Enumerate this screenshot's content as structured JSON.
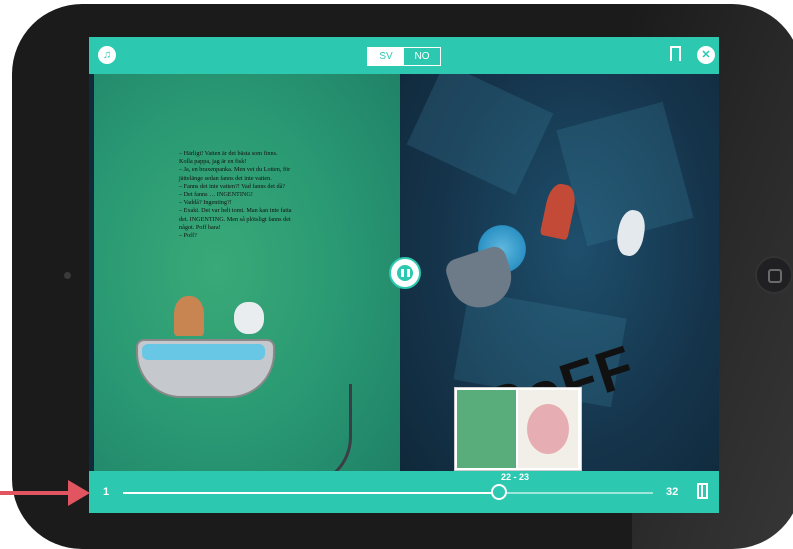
{
  "topbar": {
    "language_options": [
      "SV",
      "NO"
    ],
    "active_language": "SV",
    "icons": [
      "speaker-icon",
      "bookmark-icon",
      "close-icon"
    ]
  },
  "story": {
    "lines": [
      "– Härligt! Vatten är det bästa som finns.",
      "Kolla pappa, jag är en fisk!",
      "– Ja, en braxenpanka. Men vet du Lotten, för",
      "jättelänge sedan fanns det inte vatten.",
      "– Fanns det inte vatten?! Vad fanns det då?",
      "– Det fanns … INGENTING!",
      "– Vaddå? Ingenting?!",
      "– Exakt. Det var helt tomt. Man kan inte fatta",
      "det. INGENTING. Men så plötsligt fanns det",
      "något. Poff bara!",
      "– Poff?"
    ],
    "poff_word": "PoFF"
  },
  "player": {
    "pause_icon": "pause-icon",
    "current_spread": "22 - 23",
    "start_page": "1",
    "end_page": "32",
    "progress": 0.71,
    "end_icon": "book-icon"
  },
  "colors": {
    "accent": "#2cc8b0",
    "annotation_arrow": "#e05560"
  }
}
